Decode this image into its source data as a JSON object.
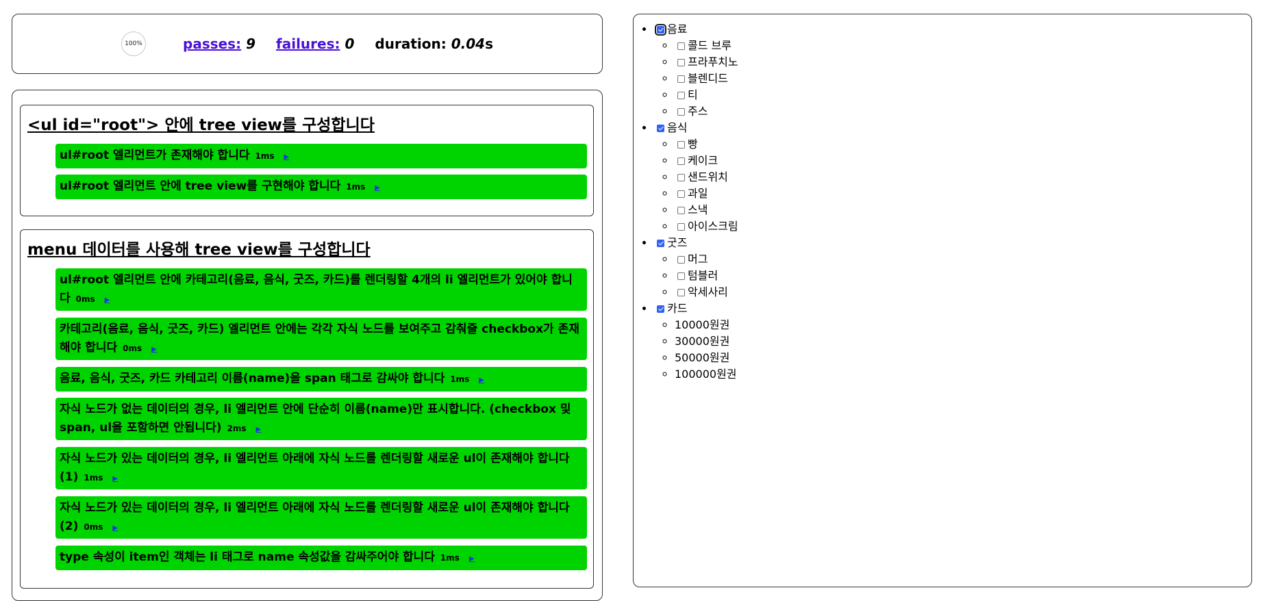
{
  "stats": {
    "progress": "100%",
    "passes_label": "passes:",
    "passes_value": "9",
    "failures_label": "failures:",
    "failures_value": "0",
    "duration_label": "duration:",
    "duration_value": "0.04",
    "duration_unit": "s"
  },
  "suites": [
    {
      "title": "<ul id=\"root\"> 안에 tree view를 구성합니다",
      "tests": [
        {
          "title": "ul#root 엘리먼트가 존재해야 합니다",
          "duration": "1ms",
          "replay": "▶"
        },
        {
          "title": "ul#root 엘리먼트 안에 tree view를 구현해야 합니다",
          "duration": "1ms",
          "replay": "▶"
        }
      ]
    },
    {
      "title": "menu 데이터를 사용해 tree view를 구성합니다",
      "tests": [
        {
          "title": "ul#root 엘리먼트 안에 카테고리(음료, 음식, 굿즈, 카드)를 렌더링할 4개의 li 엘리먼트가 있어야 합니다",
          "duration": "0ms",
          "replay": "▶"
        },
        {
          "title": "카테고리(음료, 음식, 굿즈, 카드) 엘리먼트 안에는 각각 자식 노드를 보여주고 감춰줄 checkbox가 존재해야 합니다",
          "duration": "0ms",
          "replay": "▶"
        },
        {
          "title": "음료, 음식, 굿즈, 카드 카테고리 이름(name)을 span 태그로 감싸야 합니다",
          "duration": "1ms",
          "replay": "▶"
        },
        {
          "title": "자식 노드가 없는 데이터의 경우, li 엘리먼트 안에 단순히 이름(name)만 표시합니다. (checkbox 및 span, ul을 포함하면 안됩니다)",
          "duration": "2ms",
          "replay": "▶"
        },
        {
          "title": "자식 노드가 있는 데이터의 경우, li 엘리먼트 아래에 자식 노드를 렌더링할 새로운 ul이 존재해야 합니다 (1)",
          "duration": "1ms",
          "replay": "▶"
        },
        {
          "title": "자식 노드가 있는 데이터의 경우, li 엘리먼트 아래에 자식 노드를 렌더링할 새로운 ul이 존재해야 합니다 (2)",
          "duration": "0ms",
          "replay": "▶"
        },
        {
          "title": "type 속성이 item인 객체는 li 태그로 name 속성값을 감싸주어야 합니다",
          "duration": "1ms",
          "replay": "▶"
        }
      ]
    }
  ],
  "tree": [
    {
      "name": "음료",
      "checked": true,
      "focused": true,
      "children": [
        "콜드 브루",
        "프라푸치노",
        "블렌디드",
        "티",
        "주스"
      ],
      "children_have_checkbox": true
    },
    {
      "name": "음식",
      "checked": true,
      "children": [
        "빵",
        "케이크",
        "샌드위치",
        "과일",
        "스낵",
        "아이스크림"
      ],
      "children_have_checkbox": true
    },
    {
      "name": "굿즈",
      "checked": true,
      "children": [
        "머그",
        "텀블러",
        "악세사리"
      ],
      "children_have_checkbox": true
    },
    {
      "name": "카드",
      "checked": true,
      "children": [
        "10000원권",
        "30000원권",
        "50000원권",
        "100000원권"
      ],
      "children_have_checkbox": false
    }
  ]
}
